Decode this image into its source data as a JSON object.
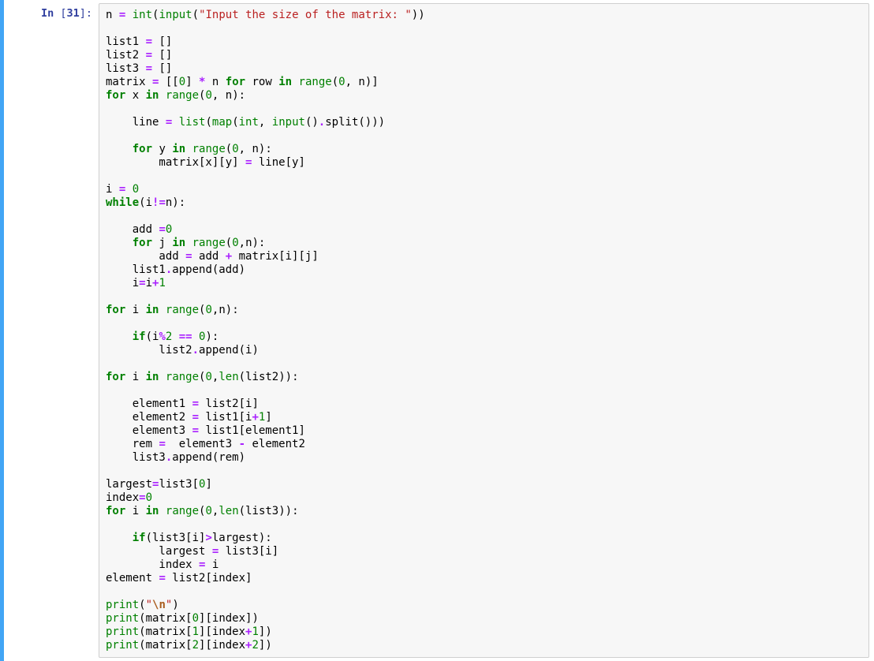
{
  "prompt": {
    "label": "In",
    "num": "31"
  },
  "code": {
    "tokens": [
      [
        [
          "n",
          "n "
        ],
        [
          "op",
          "="
        ],
        [
          "n",
          " "
        ],
        [
          "nb",
          "int"
        ],
        [
          "n",
          "("
        ],
        [
          "nb",
          "input"
        ],
        [
          "n",
          "("
        ],
        [
          "str",
          "\"Input the size of the matrix: \""
        ],
        [
          "n",
          "))"
        ]
      ],
      [],
      [
        [
          "n",
          "list1 "
        ],
        [
          "op",
          "="
        ],
        [
          "n",
          " []"
        ]
      ],
      [
        [
          "n",
          "list2 "
        ],
        [
          "op",
          "="
        ],
        [
          "n",
          " []"
        ]
      ],
      [
        [
          "n",
          "list3 "
        ],
        [
          "op",
          "="
        ],
        [
          "n",
          " []"
        ]
      ],
      [
        [
          "n",
          "matrix "
        ],
        [
          "op",
          "="
        ],
        [
          "n",
          " [["
        ],
        [
          "num",
          "0"
        ],
        [
          "n",
          "] "
        ],
        [
          "op",
          "*"
        ],
        [
          "n",
          " n "
        ],
        [
          "kw",
          "for"
        ],
        [
          "n",
          " row "
        ],
        [
          "kw",
          "in"
        ],
        [
          "n",
          " "
        ],
        [
          "nb",
          "range"
        ],
        [
          "n",
          "("
        ],
        [
          "num",
          "0"
        ],
        [
          "n",
          ", n)]"
        ]
      ],
      [
        [
          "kw",
          "for"
        ],
        [
          "n",
          " x "
        ],
        [
          "kw",
          "in"
        ],
        [
          "n",
          " "
        ],
        [
          "nb",
          "range"
        ],
        [
          "n",
          "("
        ],
        [
          "num",
          "0"
        ],
        [
          "n",
          ", n):"
        ]
      ],
      [],
      [
        [
          "n",
          "    line "
        ],
        [
          "op",
          "="
        ],
        [
          "n",
          " "
        ],
        [
          "nb",
          "list"
        ],
        [
          "n",
          "("
        ],
        [
          "nb",
          "map"
        ],
        [
          "n",
          "("
        ],
        [
          "nb",
          "int"
        ],
        [
          "n",
          ", "
        ],
        [
          "nb",
          "input"
        ],
        [
          "n",
          "()"
        ],
        [
          "op",
          "."
        ],
        [
          "n",
          "split()))"
        ]
      ],
      [],
      [
        [
          "n",
          "    "
        ],
        [
          "kw",
          "for"
        ],
        [
          "n",
          " y "
        ],
        [
          "kw",
          "in"
        ],
        [
          "n",
          " "
        ],
        [
          "nb",
          "range"
        ],
        [
          "n",
          "("
        ],
        [
          "num",
          "0"
        ],
        [
          "n",
          ", n):"
        ]
      ],
      [
        [
          "n",
          "        matrix[x][y] "
        ],
        [
          "op",
          "="
        ],
        [
          "n",
          " line[y]"
        ]
      ],
      [],
      [
        [
          "n",
          "i "
        ],
        [
          "op",
          "="
        ],
        [
          "n",
          " "
        ],
        [
          "num",
          "0"
        ]
      ],
      [
        [
          "kw",
          "while"
        ],
        [
          "n",
          "(i"
        ],
        [
          "op",
          "!="
        ],
        [
          "n",
          "n):"
        ]
      ],
      [],
      [
        [
          "n",
          "    add "
        ],
        [
          "op",
          "="
        ],
        [
          "num",
          "0"
        ]
      ],
      [
        [
          "n",
          "    "
        ],
        [
          "kw",
          "for"
        ],
        [
          "n",
          " j "
        ],
        [
          "kw",
          "in"
        ],
        [
          "n",
          " "
        ],
        [
          "nb",
          "range"
        ],
        [
          "n",
          "("
        ],
        [
          "num",
          "0"
        ],
        [
          "n",
          ",n):"
        ]
      ],
      [
        [
          "n",
          "        add "
        ],
        [
          "op",
          "="
        ],
        [
          "n",
          " add "
        ],
        [
          "op",
          "+"
        ],
        [
          "n",
          " matrix[i][j]"
        ]
      ],
      [
        [
          "n",
          "    list1"
        ],
        [
          "op",
          "."
        ],
        [
          "n",
          "append(add)"
        ]
      ],
      [
        [
          "n",
          "    i"
        ],
        [
          "op",
          "="
        ],
        [
          "n",
          "i"
        ],
        [
          "op",
          "+"
        ],
        [
          "num",
          "1"
        ]
      ],
      [],
      [
        [
          "kw",
          "for"
        ],
        [
          "n",
          " i "
        ],
        [
          "kw",
          "in"
        ],
        [
          "n",
          " "
        ],
        [
          "nb",
          "range"
        ],
        [
          "n",
          "("
        ],
        [
          "num",
          "0"
        ],
        [
          "n",
          ",n):"
        ]
      ],
      [],
      [
        [
          "n",
          "    "
        ],
        [
          "kw",
          "if"
        ],
        [
          "n",
          "(i"
        ],
        [
          "op",
          "%"
        ],
        [
          "num",
          "2"
        ],
        [
          "n",
          " "
        ],
        [
          "op",
          "=="
        ],
        [
          "n",
          " "
        ],
        [
          "num",
          "0"
        ],
        [
          "n",
          "):"
        ]
      ],
      [
        [
          "n",
          "        list2"
        ],
        [
          "op",
          "."
        ],
        [
          "n",
          "append(i)"
        ]
      ],
      [],
      [
        [
          "kw",
          "for"
        ],
        [
          "n",
          " i "
        ],
        [
          "kw",
          "in"
        ],
        [
          "n",
          " "
        ],
        [
          "nb",
          "range"
        ],
        [
          "n",
          "("
        ],
        [
          "num",
          "0"
        ],
        [
          "n",
          ","
        ],
        [
          "nb",
          "len"
        ],
        [
          "n",
          "(list2)):"
        ]
      ],
      [],
      [
        [
          "n",
          "    element1 "
        ],
        [
          "op",
          "="
        ],
        [
          "n",
          " list2[i]"
        ]
      ],
      [
        [
          "n",
          "    element2 "
        ],
        [
          "op",
          "="
        ],
        [
          "n",
          " list1[i"
        ],
        [
          "op",
          "+"
        ],
        [
          "num",
          "1"
        ],
        [
          "n",
          "]"
        ]
      ],
      [
        [
          "n",
          "    element3 "
        ],
        [
          "op",
          "="
        ],
        [
          "n",
          " list1[element1]"
        ]
      ],
      [
        [
          "n",
          "    rem "
        ],
        [
          "op",
          "="
        ],
        [
          "n",
          "  element3 "
        ],
        [
          "op",
          "-"
        ],
        [
          "n",
          " element2"
        ]
      ],
      [
        [
          "n",
          "    list3"
        ],
        [
          "op",
          "."
        ],
        [
          "n",
          "append(rem)"
        ]
      ],
      [],
      [
        [
          "n",
          "largest"
        ],
        [
          "op",
          "="
        ],
        [
          "n",
          "list3["
        ],
        [
          "num",
          "0"
        ],
        [
          "n",
          "]"
        ]
      ],
      [
        [
          "n",
          "index"
        ],
        [
          "op",
          "="
        ],
        [
          "num",
          "0"
        ]
      ],
      [
        [
          "kw",
          "for"
        ],
        [
          "n",
          " i "
        ],
        [
          "kw",
          "in"
        ],
        [
          "n",
          " "
        ],
        [
          "nb",
          "range"
        ],
        [
          "n",
          "("
        ],
        [
          "num",
          "0"
        ],
        [
          "n",
          ","
        ],
        [
          "nb",
          "len"
        ],
        [
          "n",
          "(list3)):"
        ]
      ],
      [],
      [
        [
          "n",
          "    "
        ],
        [
          "kw",
          "if"
        ],
        [
          "n",
          "(list3[i]"
        ],
        [
          "op",
          ">"
        ],
        [
          "n",
          "largest):"
        ]
      ],
      [
        [
          "n",
          "        largest "
        ],
        [
          "op",
          "="
        ],
        [
          "n",
          " list3[i]"
        ]
      ],
      [
        [
          "n",
          "        index "
        ],
        [
          "op",
          "="
        ],
        [
          "n",
          " i"
        ]
      ],
      [
        [
          "n",
          "element "
        ],
        [
          "op",
          "="
        ],
        [
          "n",
          " list2[index]"
        ]
      ],
      [],
      [
        [
          "nb",
          "print"
        ],
        [
          "n",
          "("
        ],
        [
          "str",
          "\""
        ],
        [
          "se",
          "\\n"
        ],
        [
          "str",
          "\""
        ],
        [
          "n",
          ")"
        ]
      ],
      [
        [
          "nb",
          "print"
        ],
        [
          "n",
          "(matrix["
        ],
        [
          "num",
          "0"
        ],
        [
          "n",
          "][index])"
        ]
      ],
      [
        [
          "nb",
          "print"
        ],
        [
          "n",
          "(matrix["
        ],
        [
          "num",
          "1"
        ],
        [
          "n",
          "][index"
        ],
        [
          "op",
          "+"
        ],
        [
          "num",
          "1"
        ],
        [
          "n",
          "])"
        ]
      ],
      [
        [
          "nb",
          "print"
        ],
        [
          "n",
          "(matrix["
        ],
        [
          "num",
          "2"
        ],
        [
          "n",
          "][index"
        ],
        [
          "op",
          "+"
        ],
        [
          "num",
          "2"
        ],
        [
          "n",
          "])"
        ]
      ]
    ]
  }
}
